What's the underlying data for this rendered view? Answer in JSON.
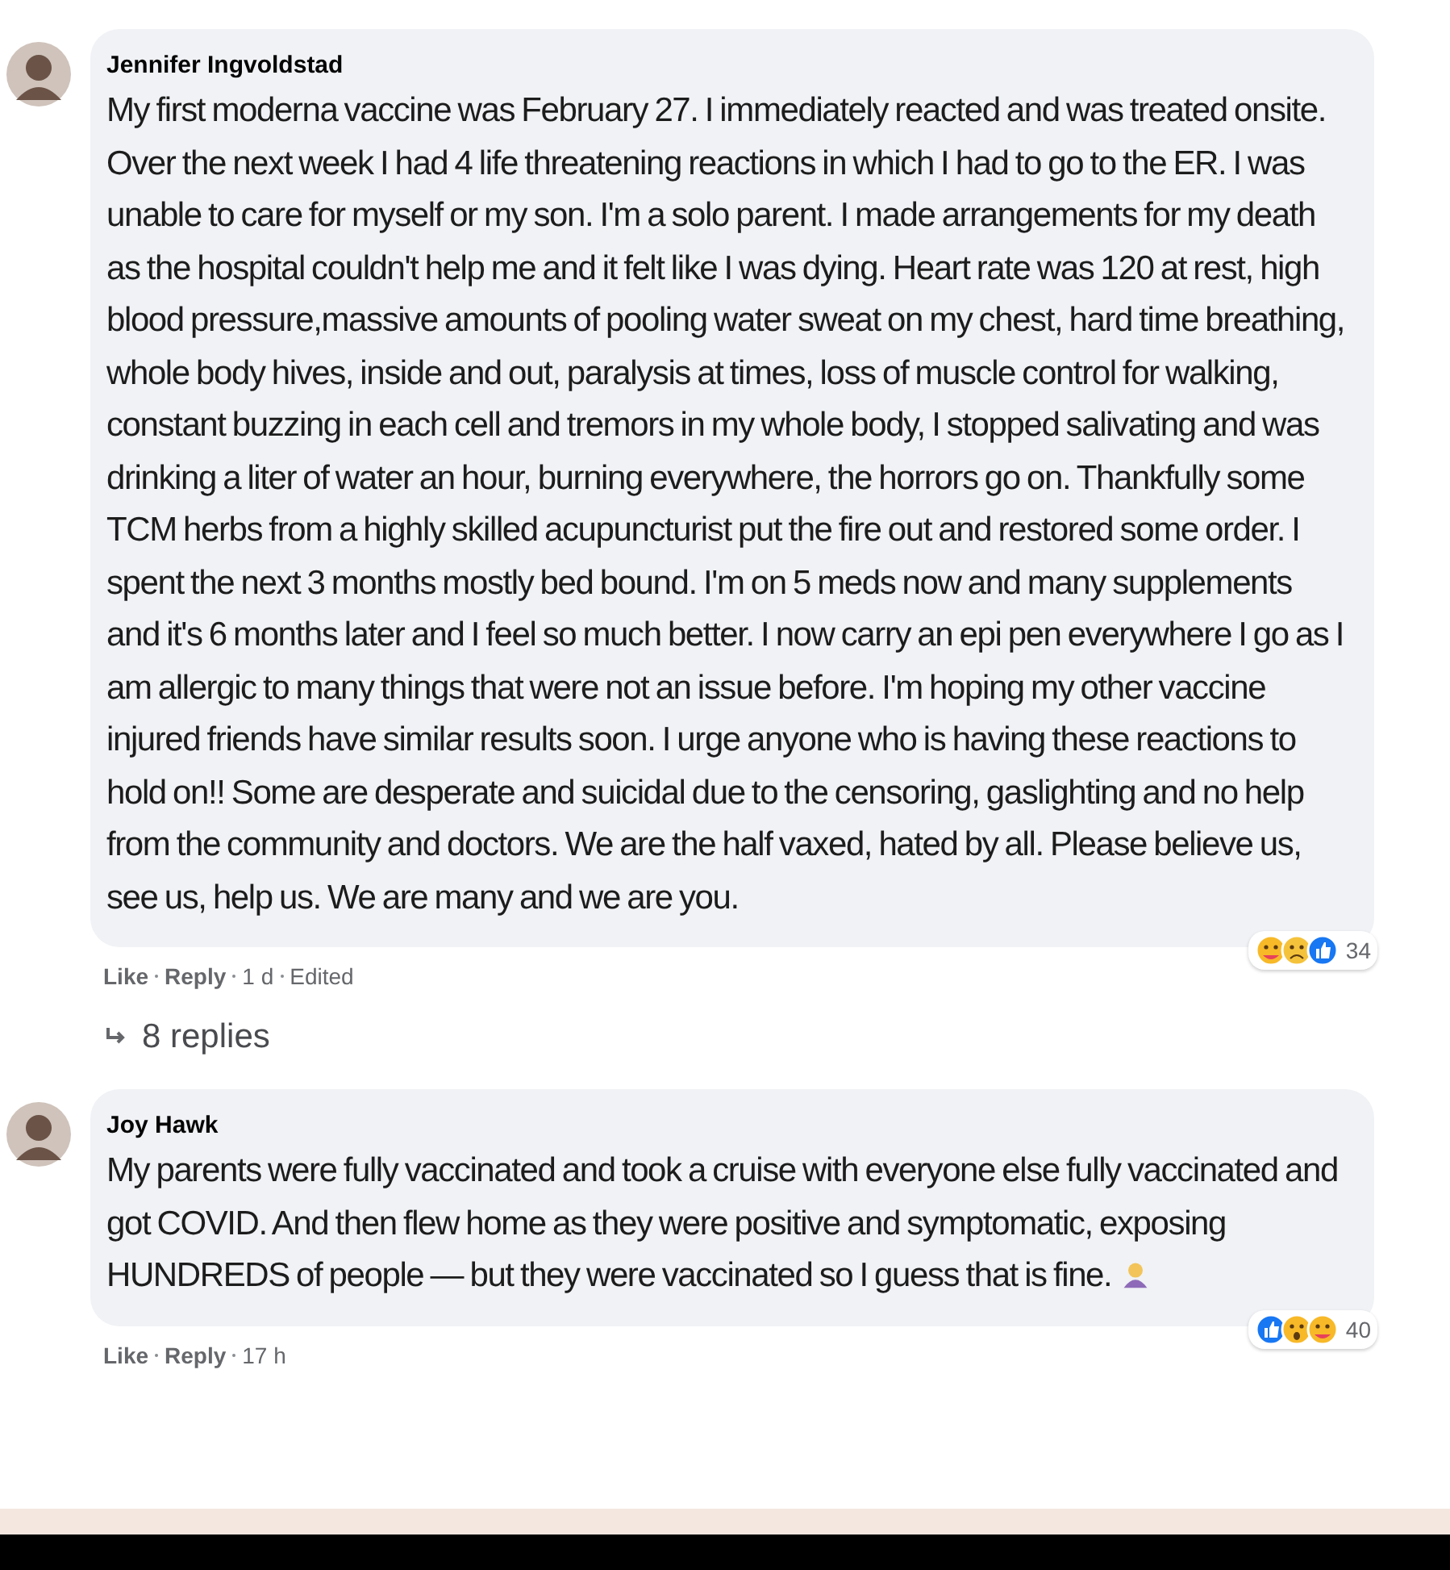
{
  "comments": [
    {
      "author": "Jennifer Ingvoldstad",
      "text": "My first moderna vaccine was February 27. I immediately reacted and was treated onsite. Over the next week I had 4 life threatening reactions in which I had to go to the ER. I was unable to care for myself or my son. I'm a solo parent. I made arrangements for my death as the hospital couldn't help me and it felt like I was dying. Heart rate was 120 at rest, high blood pressure,massive amounts of pooling water sweat on my chest, hard time breathing, whole body hives, inside and out, paralysis at times, loss of muscle control for walking, constant buzzing in each cell and tremors in my whole body, I stopped salivating and was drinking a liter of water an hour, burning everywhere, the horrors go on. Thankfully some TCM herbs from a highly skilled acupuncturist put the fire out and restored some order. I spent the next 3 months mostly bed bound. I'm on 5 meds now and many supplements and it's 6 months later and I feel so much better. I now carry an epi pen everywhere I go as I am allergic to many things that were not an issue before. I'm hoping my other vaccine injured friends have similar results soon. I urge anyone who is having these reactions to hold on!! Some are desperate and suicidal due to the censoring, gaslighting and no help from the community and doctors. We are the half vaxed, hated by all. Please believe us, see us, help us. We are many and we are you.",
      "ends_with_emoji": false,
      "reactions": [
        {
          "kind": "care"
        },
        {
          "kind": "sad"
        },
        {
          "kind": "like"
        }
      ],
      "reaction_count": "34",
      "like": "Like",
      "reply": "Reply",
      "time": "1 d",
      "edited": "Edited",
      "replies": "8 replies"
    },
    {
      "author": "Joy Hawk",
      "text": "My parents were fully vaccinated and took a cruise with everyone else fully vaccinated and got COVID. And then flew home as they were positive and symptomatic, exposing HUNDREDS of people — but they were vaccinated so I guess that is fine.",
      "ends_with_emoji": true,
      "reactions": [
        {
          "kind": "like"
        },
        {
          "kind": "wow"
        },
        {
          "kind": "care"
        }
      ],
      "reaction_count": "40",
      "like": "Like",
      "reply": "Reply",
      "time": "17 h"
    }
  ]
}
